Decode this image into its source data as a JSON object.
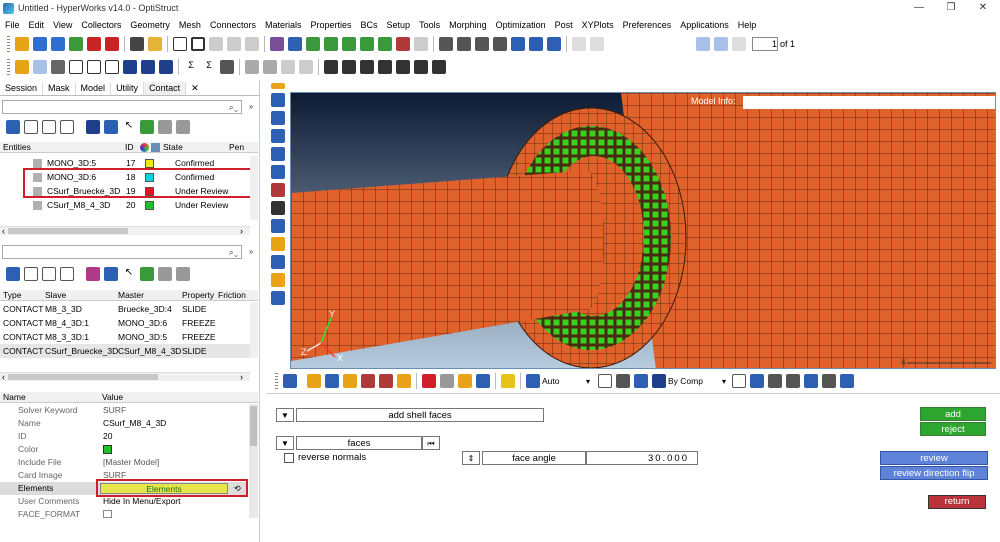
{
  "window": {
    "title": "Untitled - HyperWorks v14.0 - OptiStruct",
    "minimize": "—",
    "restore": "❐",
    "close": "✕"
  },
  "menubar": [
    "File",
    "Edit",
    "View",
    "Collectors",
    "Geometry",
    "Mesh",
    "Connectors",
    "Materials",
    "Properties",
    "BCs",
    "Setup",
    "Tools",
    "Morphing",
    "Optimization",
    "Post",
    "XYPlots",
    "Preferences",
    "Applications",
    "Help"
  ],
  "page": {
    "current": "1",
    "of_label": "of 1"
  },
  "browser_tabs": [
    "Session",
    "Mask",
    "Model",
    "Utility",
    "Contact"
  ],
  "entities_table": {
    "headers": {
      "entities": "Entities",
      "id": "ID",
      "state": "State",
      "pen": "Pen"
    },
    "rows": [
      {
        "name": "MONO_3D:5",
        "id": "17",
        "color": "#f4e90f",
        "state": "Confirmed"
      },
      {
        "name": "MONO_3D:6",
        "id": "18",
        "color": "#12d2e6",
        "state": "Confirmed"
      },
      {
        "name": "CSurf_Bruecke_3D",
        "id": "19",
        "color": "#e0151d",
        "state": "Under Review"
      },
      {
        "name": "CSurf_M8_4_3D",
        "id": "20",
        "color": "#22c127",
        "state": "Under Review"
      }
    ]
  },
  "contact_table": {
    "headers": {
      "type": "Type",
      "slave": "Slave",
      "master": "Master",
      "property": "Property",
      "friction": "Friction"
    },
    "rows": [
      {
        "type": "CONTACT",
        "slave": "M8_3_3D",
        "master": "Bruecke_3D:4",
        "property": "SLIDE"
      },
      {
        "type": "CONTACT",
        "slave": "M8_4_3D:1",
        "master": "MONO_3D:6",
        "property": "FREEZE"
      },
      {
        "type": "CONTACT",
        "slave": "M8_3_3D:1",
        "master": "MONO_3D:5",
        "property": "FREEZE"
      },
      {
        "type": "CONTACT",
        "slave": "CSurf_Bruecke_3D",
        "master": "CSurf_M8_4_3D",
        "property": "SLIDE"
      }
    ]
  },
  "properties": {
    "headers": {
      "name": "Name",
      "value": "Value"
    },
    "rows": [
      {
        "k": "Solver Keyword",
        "v": "SURF"
      },
      {
        "k": "Name",
        "v": "CSurf_M8_4_3D"
      },
      {
        "k": "ID",
        "v": "20"
      },
      {
        "k": "Color",
        "v": ""
      },
      {
        "k": "Include File",
        "v": "[Master Model]"
      },
      {
        "k": "Card Image",
        "v": "SURF"
      },
      {
        "k": "Elements",
        "v": "Elements"
      },
      {
        "k": "User Comments",
        "v": "Hide In Menu/Export"
      },
      {
        "k": "FACE_FORMAT",
        "v": ""
      }
    ],
    "color_value": "#22c127",
    "elements_button_color": "#e6e64a"
  },
  "viewport": {
    "model_info_label": "Model Info:",
    "axis_labels": {
      "x": "X",
      "y": "Y",
      "z": "Z"
    },
    "bg_top": "#0c1a33",
    "bg_bottom": "#b9cde0",
    "mesh_color": "#e0622a",
    "solid_color": "#39d11f",
    "scale_label": "4"
  },
  "bottom_toolbar": {
    "auto_label": "Auto",
    "bycomp_label": "By Comp"
  },
  "panel": {
    "add_shell_faces": "add shell faces",
    "faces": "faces",
    "reverse_normals": "reverse normals",
    "face_angle_label": "face angle",
    "face_angle_value": "30.000",
    "add": "add",
    "reject": "reject",
    "review": "review",
    "review_direction_flip": "review direction flip",
    "return": "return"
  }
}
